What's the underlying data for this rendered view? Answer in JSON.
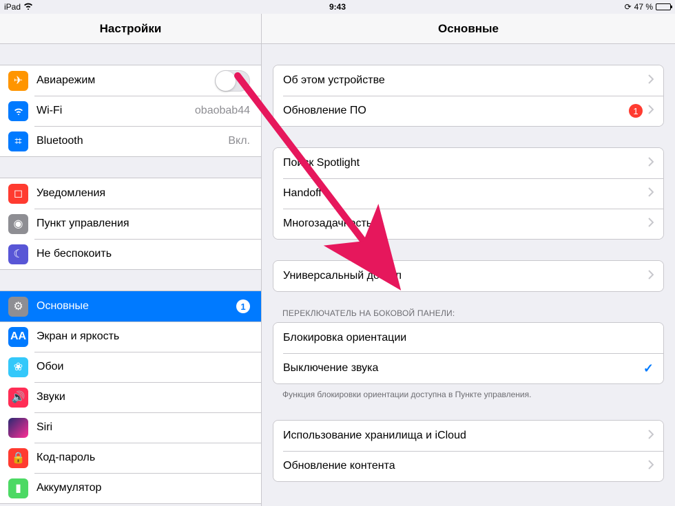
{
  "statusbar": {
    "device": "iPad",
    "time": "9:43",
    "battery_text": "47 %"
  },
  "sidebar": {
    "title": "Настройки",
    "rows": {
      "airplane": "Авиарежим",
      "wifi": "Wi-Fi",
      "wifi_value": "obaobab44",
      "bluetooth": "Bluetooth",
      "bluetooth_value": "Вкл.",
      "notifications": "Уведомления",
      "control_center": "Пункт управления",
      "dnd": "Не беспокоить",
      "general": "Основные",
      "general_badge": "1",
      "display": "Экран и яркость",
      "wallpaper": "Обои",
      "sounds": "Звуки",
      "siri": "Siri",
      "passcode": "Код-пароль",
      "battery": "Аккумулятор"
    }
  },
  "detail": {
    "title": "Основные",
    "rows": {
      "about": "Об этом устройстве",
      "software_update": "Обновление ПО",
      "software_update_badge": "1",
      "spotlight": "Поиск Spotlight",
      "handoff": "Handoff",
      "multitasking": "Многозадачность",
      "accessibility": "Универсальный доступ",
      "side_switch_header": "ПЕРЕКЛЮЧАТЕЛЬ НА БОКОВОЙ ПАНЕЛИ:",
      "lock_rotation": "Блокировка ориентации",
      "mute": "Выключение звука",
      "side_switch_footer": "Функция блокировки ориентации доступна в Пункте управления.",
      "storage": "Использование хранилища и iCloud",
      "background_refresh": "Обновление контента"
    }
  }
}
